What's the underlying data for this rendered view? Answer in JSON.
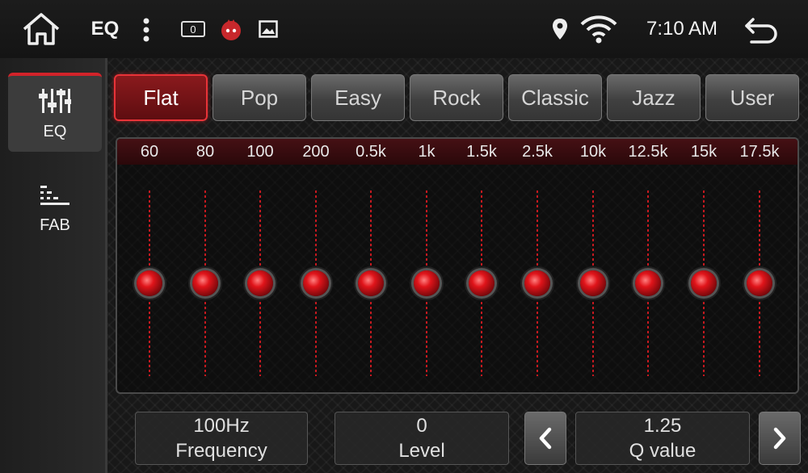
{
  "statusbar": {
    "title": "EQ",
    "notification_count": "0",
    "time": "7:10 AM",
    "icons": [
      "home-icon",
      "more-icon",
      "notification-badge-icon",
      "app-notification-icon",
      "image-icon",
      "location-icon",
      "wifi-icon",
      "back-icon"
    ]
  },
  "sidebar": {
    "items": [
      {
        "label": "EQ",
        "icon": "eq-sliders-icon",
        "active": true
      },
      {
        "label": "FAB",
        "icon": "fader-balance-icon",
        "active": false
      }
    ]
  },
  "presets": [
    {
      "label": "Flat",
      "active": true
    },
    {
      "label": "Pop",
      "active": false
    },
    {
      "label": "Easy",
      "active": false
    },
    {
      "label": "Rock",
      "active": false
    },
    {
      "label": "Classic",
      "active": false
    },
    {
      "label": "Jazz",
      "active": false
    },
    {
      "label": "User",
      "active": false
    }
  ],
  "eq": {
    "bands": [
      {
        "freq": "60",
        "level": 0
      },
      {
        "freq": "80",
        "level": 0
      },
      {
        "freq": "100",
        "level": 0
      },
      {
        "freq": "200",
        "level": 0
      },
      {
        "freq": "0.5k",
        "level": 0
      },
      {
        "freq": "1k",
        "level": 0
      },
      {
        "freq": "1.5k",
        "level": 0
      },
      {
        "freq": "2.5k",
        "level": 0
      },
      {
        "freq": "10k",
        "level": 0
      },
      {
        "freq": "12.5k",
        "level": 0
      },
      {
        "freq": "15k",
        "level": 0
      },
      {
        "freq": "17.5k",
        "level": 0
      }
    ]
  },
  "controls": {
    "frequency_value": "100Hz",
    "frequency_label": "Frequency",
    "level_value": "0",
    "level_label": "Level",
    "q_value": "1.25",
    "q_label": "Q value"
  },
  "colors": {
    "accent": "#d2232a",
    "background": "#121212"
  }
}
